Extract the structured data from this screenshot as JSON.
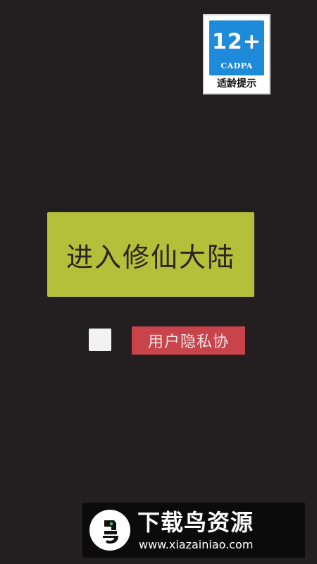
{
  "age_rating": {
    "number": "12+",
    "org": "CADPA",
    "hint": "适龄提示"
  },
  "enter_button_label": "进入修仙大陆",
  "agreement": {
    "checked": false,
    "link_label": "用户隐私协"
  },
  "watermark": {
    "title": "下载鸟资源",
    "url": "www.xiazainiao.com",
    "icon": "bird-logo-icon"
  },
  "colors": {
    "background": "#231f20",
    "enter_button": "#b4bf3a",
    "agreement_button": "#c9434a",
    "age_badge_blue": "#1d8bd9"
  }
}
